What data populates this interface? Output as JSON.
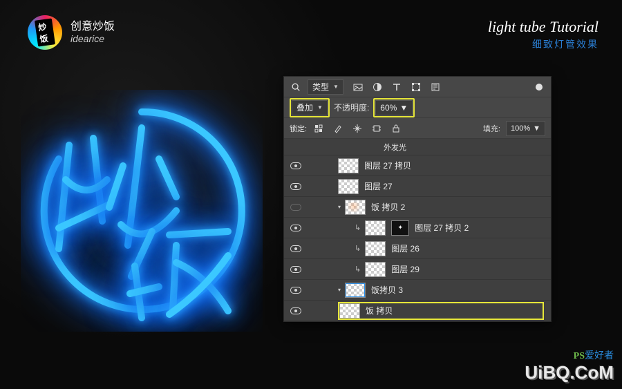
{
  "header": {
    "logo_cn": "创意炒饭",
    "logo_en": "idearice"
  },
  "title": {
    "en": "light tube Tutorial",
    "cn": "细致灯管效果"
  },
  "panel": {
    "filter_label": "类型",
    "blend_mode": "叠加",
    "opacity_label": "不透明度:",
    "opacity_value": "60%",
    "lock_label": "锁定:",
    "fill_label": "填充:",
    "fill_value": "100%",
    "effect_label": "外发光",
    "layers": [
      {
        "name": "图层 27 拷贝",
        "indent": 1,
        "visible": true,
        "linkarrow": false,
        "mask": false
      },
      {
        "name": "图层 27",
        "indent": 1,
        "visible": true,
        "linkarrow": false,
        "mask": false
      },
      {
        "name": "饭 拷贝 2",
        "indent": 1,
        "visible": false,
        "linkarrow": false,
        "mask": false,
        "fx": true,
        "caret": true
      },
      {
        "name": "图层 27 拷贝 2",
        "indent": 2,
        "visible": true,
        "linkarrow": true,
        "mask": true
      },
      {
        "name": "图层 26",
        "indent": 2,
        "visible": true,
        "linkarrow": true,
        "mask": false
      },
      {
        "name": "图层 29",
        "indent": 2,
        "visible": true,
        "linkarrow": true,
        "mask": false
      },
      {
        "name": "饭拷贝 3",
        "indent": 1,
        "visible": true,
        "linkarrow": false,
        "mask": false,
        "stroked": true,
        "caret": true
      },
      {
        "name": "饭 拷贝",
        "indent": 1,
        "visible": true,
        "linkarrow": false,
        "mask": false,
        "highlighted": true
      }
    ]
  },
  "watermark": {
    "top_ps": "PS",
    "top_sub": "爱好者",
    "url": "UiBQ.CoM"
  },
  "colors": {
    "neon": "#3bc8ff",
    "highlight": "#e6e639"
  }
}
